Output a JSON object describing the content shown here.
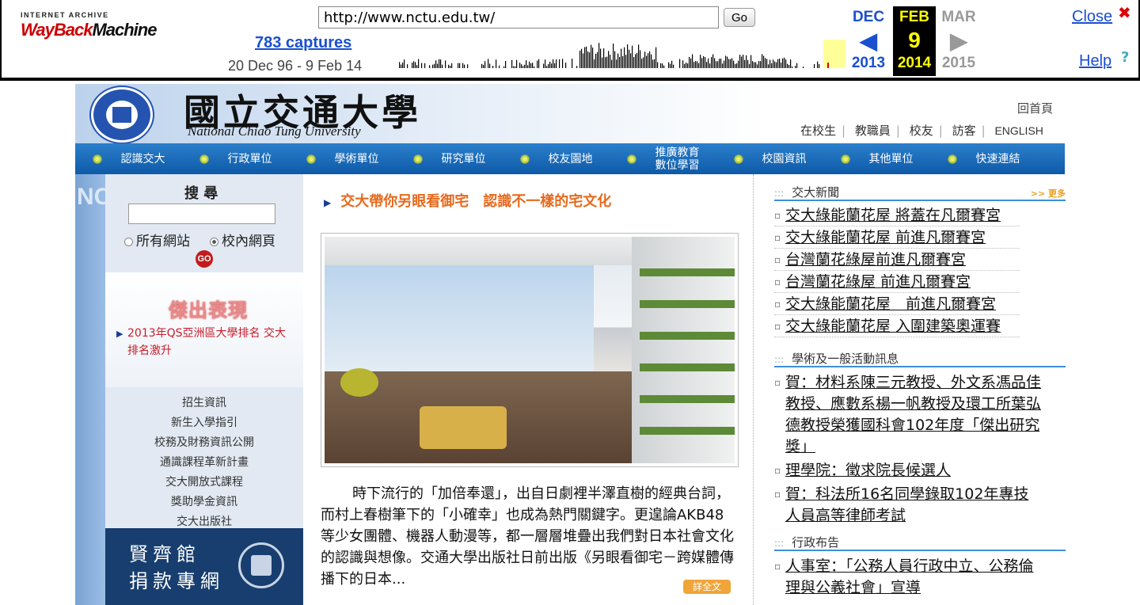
{
  "wayback": {
    "logo_top": "INTERNET ARCHIVE",
    "logo_wayback": "WayBack",
    "logo_machine": "Machine",
    "url_value": "http://www.nctu.edu.tw/",
    "go_label": "Go",
    "captures": "783 captures",
    "range": "20 Dec 96 - 9 Feb 14",
    "cal": {
      "prev_month": "DEC",
      "prev_year": "2013",
      "cur_month": "FEB",
      "cur_day": "9",
      "cur_year": "2014",
      "next_month": "MAR",
      "next_year": "2015"
    },
    "close_label": "Close",
    "help_label": "Help"
  },
  "site": {
    "name_zh": "國立交通大學",
    "name_en": "National Chiao Tung University",
    "home_link": "回首頁",
    "top_links": [
      "在校生",
      "教職員",
      "校友",
      "訪客",
      "ENGLISH"
    ],
    "nav": [
      "認識交大",
      "行政單位",
      "學術單位",
      "研究單位",
      "校友園地",
      "推廣教育\n數位學習",
      "校園資訊",
      "其他單位",
      "快速連結"
    ],
    "strip_text": "NCTU",
    "search": {
      "title": "搜 尋",
      "option_all": "所有網站",
      "option_campus": "校內網頁",
      "go": "GO"
    },
    "feature": {
      "title": "傑出表現",
      "link": "2013年QS亞洲區大學排名 交大排名激升"
    },
    "quick_links": [
      "招生資訊",
      "新生入學指引",
      "校務及財務資訊公開",
      "通識課程革新計畫",
      "交大開放式課程",
      "獎助學金資訊",
      "交大出版社"
    ],
    "donate": [
      "賢齊館",
      "捐款專網"
    ],
    "headline": "交大帶你另眼看御宅　認識不一樣的宅文化",
    "story": "時下流行的「加倍奉還」，出自日劇裡半澤直樹的經典台詞，而村上春樹筆下的「小確幸」也成為熱門關鍵字。更遑論AKB48等少女團體、機器人動漫等，都一層層堆疊出我們對日本社會文化的認識與想像。交通大學出版社日前出版《另眼看御宅－跨媒體傳播下的日本...",
    "read_more": "詳全文",
    "news_head": "交大新聞",
    "news_more": ">> 更多",
    "news": [
      "交大綠能蘭花屋 將蓋在凡爾賽宮",
      "交大綠能蘭花屋 前進凡爾賽宮",
      "台灣蘭花綠屋前進凡爾賽宮",
      "台灣蘭花綠屋 前進凡爾賽宮",
      "交大綠能蘭花屋　前進凡爾賽宮",
      "交大綠能蘭花屋 入圍建築奧運賽"
    ],
    "academic_head": "學術及一般活動訊息",
    "academic": [
      "賀：材料系陳三元教授、外文系馮品佳教授、應數系楊一帆教授及環工所葉弘德教授榮獲國科會102年度「傑出研究獎」",
      "理學院：徵求院長候選人",
      "賀：科法所16名同學錄取102年專技人員高等律師考試"
    ],
    "admin_head": "行政布告",
    "admin": [
      "人事室：「公務人員行政中立、公務倫理與公義社會」宣導"
    ]
  }
}
